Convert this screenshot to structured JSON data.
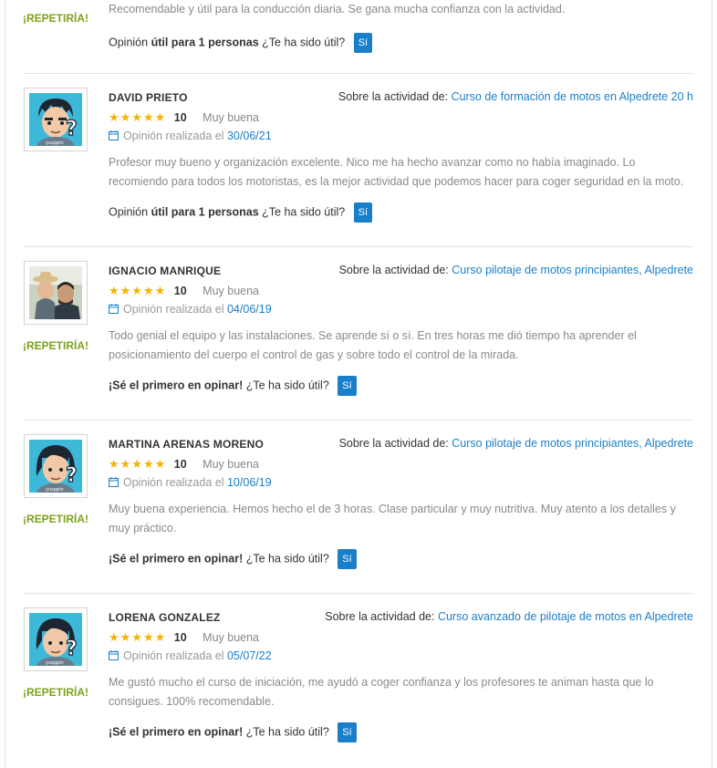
{
  "top_review": {
    "text": "Recomendable y útil para la conducción diaria. Se gana mucha confianza con la actividad.",
    "repeat": "¡REPETIRÍA!",
    "useful_prefix": "Opinión",
    "useful_bold": "útil para 1 personas",
    "question": "¿Te ha sido útil?",
    "button": "Sí"
  },
  "common": {
    "activity_label": "Sobre la actividad de:",
    "date_prefix": "Opinión realizada el",
    "question": "¿Te ha sido útil?",
    "button": "Sí",
    "repeat": "¡REPETIRÍA!",
    "first_opinion": "¡Sé el primero en opinar!",
    "useful_prefix": "Opinión",
    "useful_bold": "útil para 1 personas",
    "stars": "★★★★★"
  },
  "reviews": [
    {
      "name": "DAVID PRIETO",
      "activity": "Curso de formación de motos en Alpedrete 20 h",
      "score": "10",
      "score_label": "Muy buena",
      "date": "30/06/21",
      "text": "Profesor muy bueno y organización excelente. Nico me ha hecho avanzar como no había imaginado. Lo recomiendo para todos los motoristas, es la mejor actividad que podemos hacer para coger seguridad en la moto.",
      "avatar": "default-avatar-icon"
    },
    {
      "name": "IGNACIO MANRIQUE",
      "activity": "Curso pilotaje de motos principiantes, Alpedrete",
      "score": "10",
      "score_label": "Muy buena",
      "date": "04/06/19",
      "text": "Todo genial el equipo y las instalaciones. Se aprende sí o sí. En tres horas me dió tiempo ha aprender el posicionamiento del cuerpo el control de gas y sobre todo el control de la mirada.",
      "avatar": "user-photo"
    },
    {
      "name": "MARTINA ARENAS MORENO",
      "activity": "Curso pilotaje de motos principiantes, Alpedrete",
      "score": "10",
      "score_label": "Muy buena",
      "date": "10/06/19",
      "text": "Muy buena experiencia. Hemos hecho el de 3 horas. Clase particular y muy nutritiva. Muy atento a los detalles y muy práctico.",
      "avatar": "default-avatar-icon"
    },
    {
      "name": "LORENA GONZALEZ",
      "activity": "Curso avanzado de pilotaje de motos en Alpedrete",
      "score": "10",
      "score_label": "Muy buena",
      "date": "05/07/22",
      "text": "Me gustó mucho el curso de iniciación, me ayudó a coger confianza y los profesores te animan hasta que lo consigues. 100% recomendable.",
      "avatar": "default-avatar-icon"
    }
  ],
  "colors": {
    "accent": "#1a7fc9",
    "repeat": "#7da21a",
    "stars": "#f5b301"
  }
}
